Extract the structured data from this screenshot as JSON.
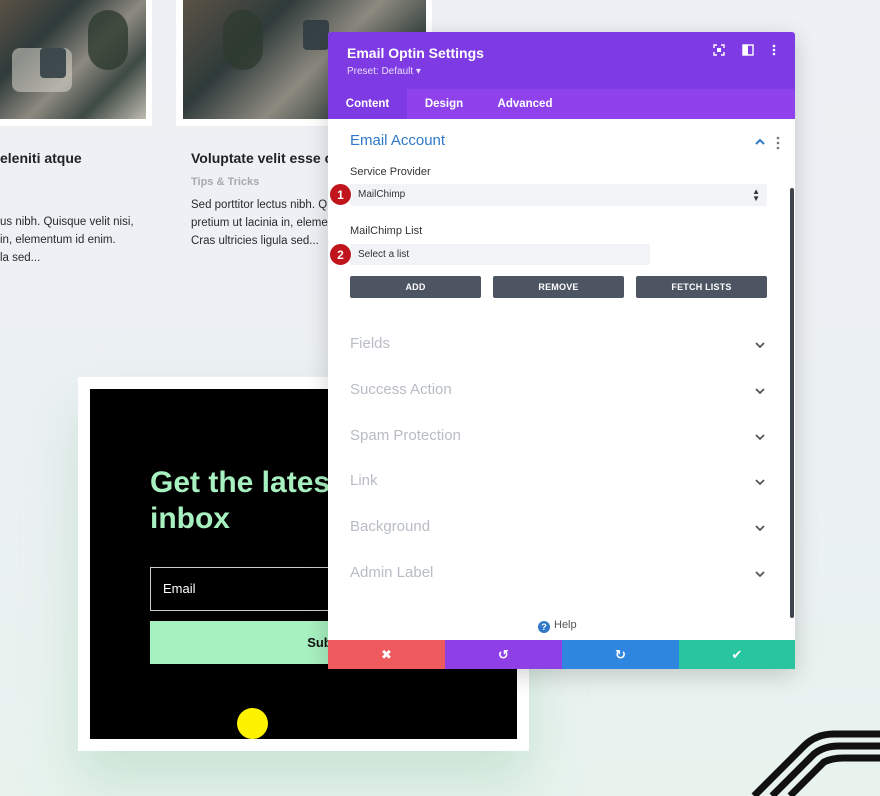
{
  "background_page": {
    "post_left": {
      "title": "eleniti atque",
      "excerpt": [
        "us nibh. Quisque velit nisi,",
        "in, elementum id enim.",
        "la sed..."
      ]
    },
    "post_mid": {
      "title": "Voluptate velit esse c",
      "category": "Tips & Tricks",
      "excerpt": [
        "Sed porttitor lectus nibh. Q",
        "pretium ut lacinia in, elemen",
        "Cras ultricies ligula sed..."
      ]
    },
    "optin": {
      "heading": "Get the lates\ninbox",
      "email_placeholder": "Email",
      "submit_label": "Subscrib"
    }
  },
  "panel": {
    "title": "Email Optin Settings",
    "preset": "Preset: Default ▾",
    "header_icons": [
      "focus-icon",
      "split-view-icon",
      "more-vertical-icon"
    ],
    "tabs": [
      {
        "label": "Content",
        "active": true
      },
      {
        "label": "Design",
        "active": false
      },
      {
        "label": "Advanced",
        "active": false
      }
    ],
    "email_account": {
      "title": "Email Account",
      "service_provider_label": "Service Provider",
      "service_provider_value": "MailChimp",
      "list_label": "MailChimp List",
      "list_value": "Select a list",
      "buttons": [
        "ADD",
        "REMOVE",
        "FETCH LISTS"
      ]
    },
    "sections": [
      "Fields",
      "Success Action",
      "Spam Protection",
      "Link",
      "Background",
      "Admin Label"
    ],
    "markers": [
      "1",
      "2"
    ],
    "help": "Help",
    "footer": {
      "cancel": "✖",
      "undo": "↺",
      "redo": "↻",
      "save": "✔",
      "colors": {
        "cancel": "#ef5a5f",
        "undo": "#8e3fe6",
        "redo": "#2f86de",
        "save": "#29c4a0"
      }
    }
  },
  "colors": {
    "accent_purple": "#7e3be3",
    "tab_bar": "#8f42ec",
    "link_blue": "#2f79c7",
    "optin_green": "#a7f0c0"
  }
}
